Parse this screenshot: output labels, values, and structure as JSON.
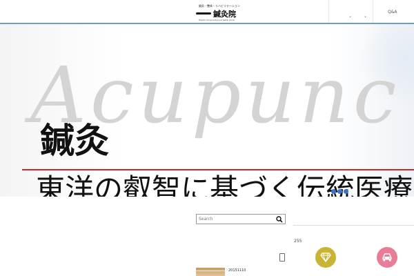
{
  "header": {
    "logo_small_top": "鍼灸・整体・リハビリテーション",
    "logo_main": "鍼灸院",
    "logo_small_bottom": "Hashiri Acupuncture & Seitai Clinic",
    "nav_qa": "Q&A",
    "chevron": "⌄",
    "accent_color": "#6a9fc9"
  },
  "hero": {
    "bg_word": "Acupunc",
    "title": "鍼灸",
    "subtitle": "東洋の叡智に基づく伝統医療",
    "red_line_color": "#c8282d",
    "dot_color": "#3d73c4",
    "slide_count": 3
  },
  "sidebar": {
    "search": {
      "placeholder": "Search",
      "value": ""
    },
    "count_text": "255",
    "post_date": "20151110"
  },
  "floating": {
    "diamond_color": "#c8b534",
    "car_color": "#e97d97",
    "diamond_icon": "diamond-icon",
    "car_icon": "car-icon"
  }
}
